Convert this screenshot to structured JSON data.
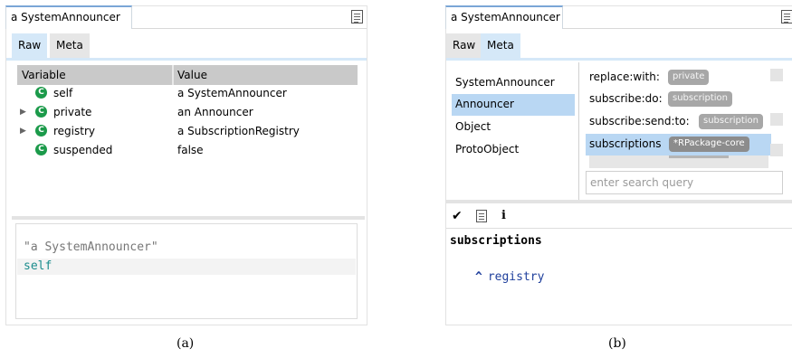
{
  "panel_a": {
    "window_title": "a SystemAnnouncer",
    "tabs": [
      "Raw",
      "Meta"
    ],
    "table": {
      "headers": [
        "Variable",
        "Value"
      ],
      "rows": [
        {
          "name": "self",
          "value": "a SystemAnnouncer",
          "expandable": false
        },
        {
          "name": "private",
          "value": "an Announcer",
          "expandable": true
        },
        {
          "name": "registry",
          "value": "a SubscriptionRegistry",
          "expandable": true
        },
        {
          "name": "suspended",
          "value": "false",
          "expandable": false
        }
      ]
    },
    "code": {
      "line1": "\"a SystemAnnouncer\"",
      "line2": "self"
    },
    "caption": "(a)"
  },
  "panel_b": {
    "window_title": "a SystemAnnouncer",
    "tabs": [
      "Raw",
      "Meta"
    ],
    "classes": [
      "SystemAnnouncer",
      "Announcer",
      "Object",
      "ProtoObject"
    ],
    "methods": [
      {
        "name": "replace:with:",
        "protocol": "private"
      },
      {
        "name": "subscribe:do:",
        "protocol": "subscription"
      },
      {
        "name": "subscribe:send:to:",
        "protocol": "subscription"
      },
      {
        "name": "subscriptions",
        "protocol": "*RPackage-core"
      }
    ],
    "search_placeholder": "enter search query",
    "toolbar": {
      "accept": "✔",
      "info": "i"
    },
    "code": {
      "selector": "subscriptions",
      "return_symbol": "^",
      "return_expr": "registry"
    },
    "caption": "(b)"
  },
  "icon_names": [
    "document-icon",
    "class-icon",
    "triangle-expand-icon",
    "checkmark-icon",
    "info-icon"
  ]
}
